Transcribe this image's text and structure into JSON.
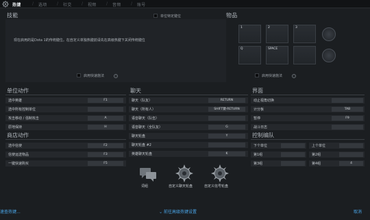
{
  "tabs": [
    {
      "label": "热键"
    },
    {
      "label": "选项"
    },
    {
      "label": "社交"
    },
    {
      "label": "视频"
    },
    {
      "label": "音频"
    },
    {
      "label": "账号"
    }
  ],
  "hotkeys": {
    "title": "技能",
    "unit_checkbox_label": "单位特定键位",
    "notice": "现在启用的是Dota 1的传统键位。在自定义单独热键前请先在高级热键下关闭传统键位",
    "quickcast_label": "启用快速施法"
  },
  "items": {
    "title": "物品",
    "slots": [
      "1",
      "2",
      "3",
      "Q",
      "SPACE",
      ""
    ],
    "quickcast_label": "启用快速施法"
  },
  "unit_actions": {
    "title": "单位动作",
    "rows": [
      {
        "label": "选中英雄",
        "key": "F1"
      },
      {
        "label": "选中所有控制单位",
        "key": ""
      },
      {
        "label": "攻击移动 / 强制攻击",
        "key": "A"
      },
      {
        "label": "原地保持",
        "key": "H"
      }
    ]
  },
  "shop_actions": {
    "title": "商店动作",
    "rows": [
      {
        "label": "选中信使",
        "key": "F2"
      },
      {
        "label": "信使运送物品",
        "key": "F3"
      },
      {
        "label": "一键快速购买",
        "key": "F5"
      }
    ]
  },
  "chat": {
    "title": "聊天",
    "rows": [
      {
        "label": "聊天（队友）",
        "key": "RETURN"
      },
      {
        "label": "聊天（所有人）",
        "key": "SHIFT键-RETURN"
      },
      {
        "label": "语音聊天（队伍）",
        "key": ""
      },
      {
        "label": "语音聊天（全队友）",
        "key": "G"
      },
      {
        "label": "聊天轮盘",
        "key": "Y"
      },
      {
        "label": "聊天轮盘 #2",
        "key": ""
      },
      {
        "label": "英雄聊天轮盘",
        "key": "K"
      }
    ]
  },
  "interface": {
    "title": "界面",
    "rows": [
      {
        "label": "动止视角切换",
        "key": ""
      },
      {
        "label": "计分板",
        "key": "TAB"
      },
      {
        "label": "暂停",
        "key": "F9"
      },
      {
        "label": "战斗日志",
        "key": ""
      }
    ]
  },
  "control_groups": {
    "title": "控制编队",
    "rows": [
      {
        "left_label": "下个单位",
        "left_key": "",
        "right_label": "上个单位",
        "right_key": ""
      },
      {
        "left_label": "第1组",
        "left_key": "",
        "right_label": "第2组",
        "right_key": ""
      },
      {
        "left_label": "第3组",
        "left_key": "",
        "right_label": "第4组",
        "right_key": "4"
      }
    ]
  },
  "bottom_buttons": [
    {
      "label": "词组"
    },
    {
      "label": "自定义聊天轮盘"
    },
    {
      "label": "自定义信号轮盘"
    }
  ],
  "footer": {
    "left_link": "速查热键...",
    "center_link": "前往高级热键设置",
    "right_link": "取消"
  },
  "colors": {
    "background": "#1b1e21",
    "row": "#25282c",
    "keybox": "#34383d",
    "link": "#4aa6e8"
  }
}
